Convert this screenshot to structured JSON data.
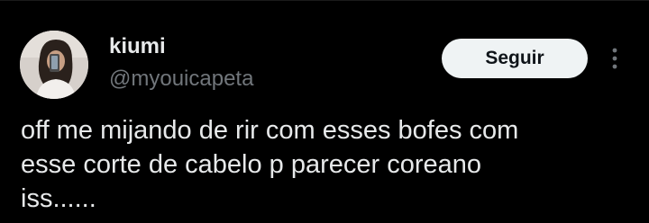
{
  "author": {
    "display_name": "kiumi",
    "handle": "@myouicapeta",
    "avatar_icon": "profile-photo-avatar"
  },
  "actions": {
    "follow_label": "Seguir",
    "more_icon": "more-options-icon"
  },
  "tweet": {
    "text": "off me mijando de rir com esses bofes com\nesse corte de cabelo p parecer coreano\niss......"
  },
  "colors": {
    "background": "#000000",
    "primary_text": "#e7e9ea",
    "secondary_text": "#71767b",
    "button_bg": "#eff3f4",
    "button_text": "#0f1419"
  }
}
